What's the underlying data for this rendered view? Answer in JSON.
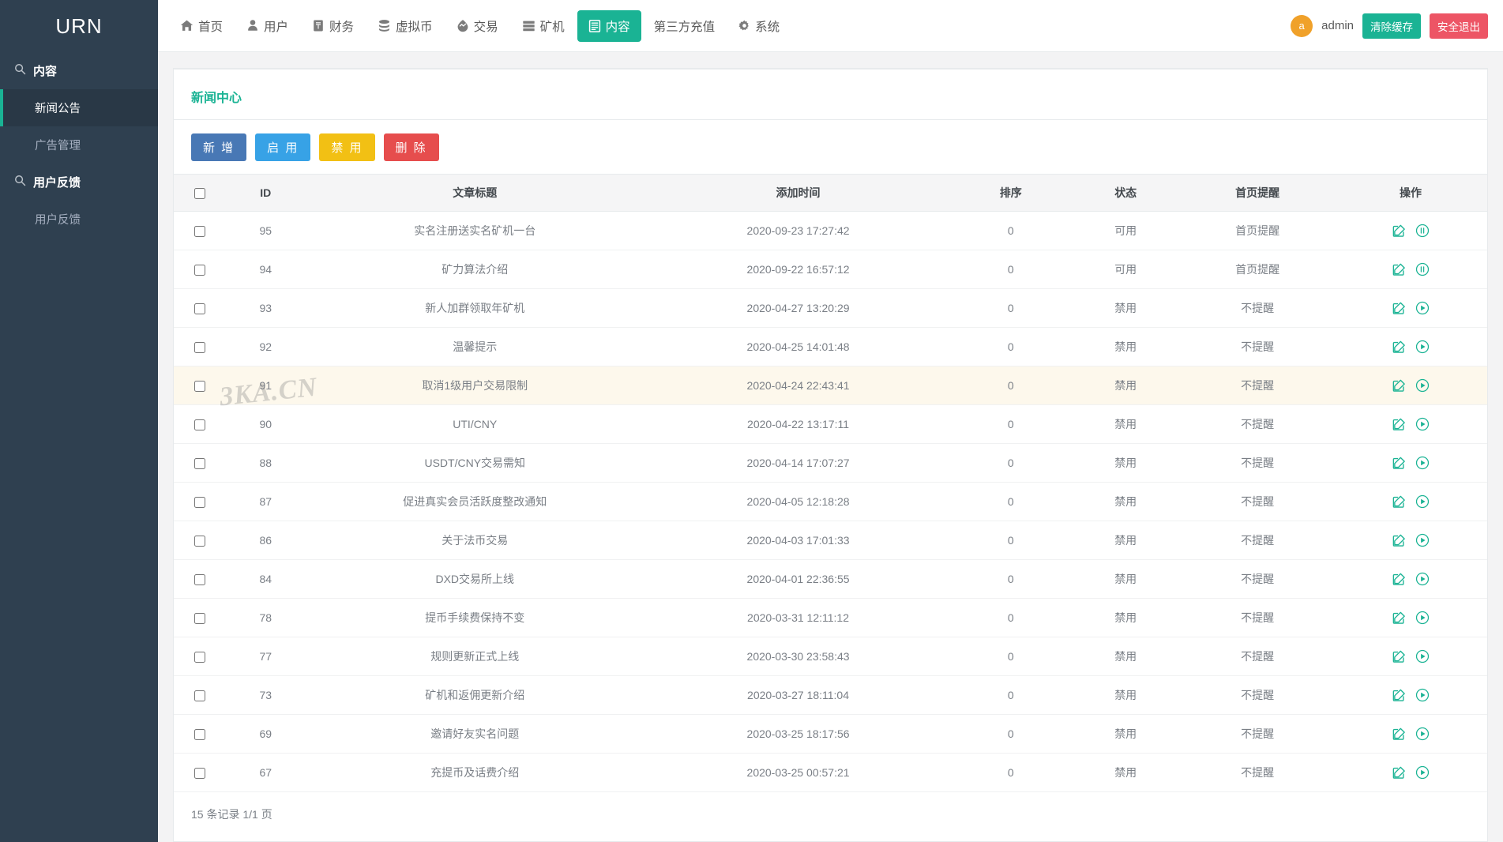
{
  "sidebar": {
    "brand": "URN",
    "groups": [
      {
        "label": "内容",
        "icon": "search-icon",
        "items": [
          {
            "label": "新闻公告",
            "active": true
          },
          {
            "label": "广告管理",
            "active": false
          }
        ]
      },
      {
        "label": "用户反馈",
        "icon": "search-icon",
        "items": [
          {
            "label": "用户反馈",
            "active": false
          }
        ]
      }
    ]
  },
  "topnav": {
    "items": [
      {
        "label": "首页",
        "icon": "home-icon",
        "active": false
      },
      {
        "label": "用户",
        "icon": "user-icon",
        "active": false
      },
      {
        "label": "财务",
        "icon": "money-icon",
        "active": false
      },
      {
        "label": "虚拟币",
        "icon": "coins-icon",
        "active": false
      },
      {
        "label": "交易",
        "icon": "exchange-icon",
        "active": false
      },
      {
        "label": "矿机",
        "icon": "server-icon",
        "active": false
      },
      {
        "label": "内容",
        "icon": "content-icon",
        "active": true
      },
      {
        "label": "第三方充值",
        "icon": "none",
        "active": false
      },
      {
        "label": "系统",
        "icon": "gear-icon",
        "active": false
      }
    ],
    "user": {
      "avatar_letter": "a",
      "name": "admin",
      "clear_cache_label": "清除缓存",
      "logout_label": "安全退出"
    }
  },
  "page": {
    "title": "新闻中心",
    "watermark": "3KA.CN",
    "toolbar": [
      {
        "label": "新 增",
        "name": "add-button"
      },
      {
        "label": "启 用",
        "name": "enable-button"
      },
      {
        "label": "禁 用",
        "name": "disable-button"
      },
      {
        "label": "删 除",
        "name": "delete-button"
      }
    ],
    "footer": "15 条记录 1/1 页"
  },
  "table": {
    "columns": [
      "ID",
      "文章标题",
      "添加时间",
      "排序",
      "状态",
      "首页提醒",
      "操作"
    ],
    "rows": [
      {
        "id": "95",
        "title": "实名注册送实名矿机一台",
        "time": "2020-09-23 17:27:42",
        "sort": "0",
        "state": "可用",
        "home": "首页提醒",
        "toggle": "pause-icon",
        "highlight": false
      },
      {
        "id": "94",
        "title": "矿力算法介绍",
        "time": "2020-09-22 16:57:12",
        "sort": "0",
        "state": "可用",
        "home": "首页提醒",
        "toggle": "pause-icon",
        "highlight": false
      },
      {
        "id": "93",
        "title": "新人加群领取年矿机",
        "time": "2020-04-27 13:20:29",
        "sort": "0",
        "state": "禁用",
        "home": "不提醒",
        "toggle": "play-icon",
        "highlight": false
      },
      {
        "id": "92",
        "title": "温馨提示",
        "time": "2020-04-25 14:01:48",
        "sort": "0",
        "state": "禁用",
        "home": "不提醒",
        "toggle": "play-icon",
        "highlight": false
      },
      {
        "id": "91",
        "title": "取消1级用户交易限制",
        "time": "2020-04-24 22:43:41",
        "sort": "0",
        "state": "禁用",
        "home": "不提醒",
        "toggle": "play-icon",
        "highlight": true
      },
      {
        "id": "90",
        "title": "UTI/CNY",
        "time": "2020-04-22 13:17:11",
        "sort": "0",
        "state": "禁用",
        "home": "不提醒",
        "toggle": "play-icon",
        "highlight": false
      },
      {
        "id": "88",
        "title": "USDT/CNY交易需知",
        "time": "2020-04-14 17:07:27",
        "sort": "0",
        "state": "禁用",
        "home": "不提醒",
        "toggle": "play-icon",
        "highlight": false
      },
      {
        "id": "87",
        "title": "促进真实会员活跃度整改通知",
        "time": "2020-04-05 12:18:28",
        "sort": "0",
        "state": "禁用",
        "home": "不提醒",
        "toggle": "play-icon",
        "highlight": false
      },
      {
        "id": "86",
        "title": "关于法币交易",
        "time": "2020-04-03 17:01:33",
        "sort": "0",
        "state": "禁用",
        "home": "不提醒",
        "toggle": "play-icon",
        "highlight": false
      },
      {
        "id": "84",
        "title": "DXD交易所上线",
        "time": "2020-04-01 22:36:55",
        "sort": "0",
        "state": "禁用",
        "home": "不提醒",
        "toggle": "play-icon",
        "highlight": false
      },
      {
        "id": "78",
        "title": "提币手续费保持不变",
        "time": "2020-03-31 12:11:12",
        "sort": "0",
        "state": "禁用",
        "home": "不提醒",
        "toggle": "play-icon",
        "highlight": false
      },
      {
        "id": "77",
        "title": "规则更新正式上线",
        "time": "2020-03-30 23:58:43",
        "sort": "0",
        "state": "禁用",
        "home": "不提醒",
        "toggle": "play-icon",
        "highlight": false
      },
      {
        "id": "73",
        "title": "矿机和返佣更新介绍",
        "time": "2020-03-27 18:11:04",
        "sort": "0",
        "state": "禁用",
        "home": "不提醒",
        "toggle": "play-icon",
        "highlight": false
      },
      {
        "id": "69",
        "title": "邀请好友实名问题",
        "time": "2020-03-25 18:17:56",
        "sort": "0",
        "state": "禁用",
        "home": "不提醒",
        "toggle": "play-icon",
        "highlight": false
      },
      {
        "id": "67",
        "title": "充提币及话费介绍",
        "time": "2020-03-25 00:57:21",
        "sort": "0",
        "state": "禁用",
        "home": "不提醒",
        "toggle": "play-icon",
        "highlight": false
      }
    ]
  },
  "colors": {
    "sidebar_bg": "#2f4050",
    "sidebar_active_bg": "#293846",
    "accent": "#1ab394",
    "danger": "#ed5565",
    "warning": "#f2c014",
    "info": "#37a2e6",
    "primary": "#4878b5",
    "avatar": "#f0a12a",
    "row_highlight": "#fdf8ec"
  }
}
